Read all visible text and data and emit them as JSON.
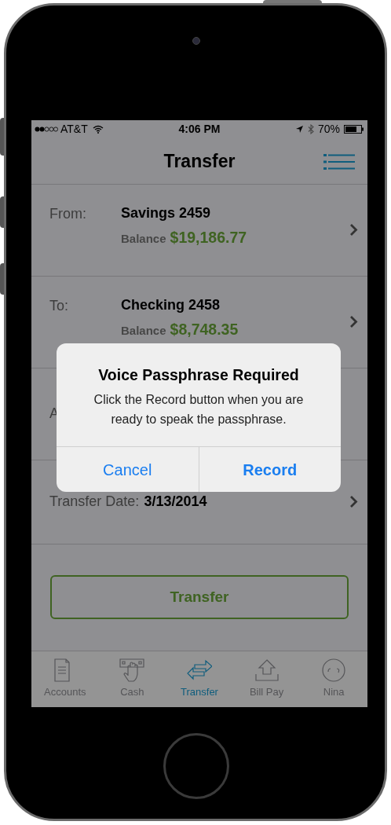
{
  "status_bar": {
    "carrier": "AT&T",
    "time": "4:06 PM",
    "battery": "70%"
  },
  "nav_bar": {
    "title": "Transfer"
  },
  "rows": [
    {
      "kind": "account",
      "label": "From:",
      "name": "Savings 2459",
      "balance_label": "Balance",
      "balance": "$19,186.77",
      "chevron": true
    },
    {
      "kind": "account",
      "label": "To:",
      "name": "Checking 2458",
      "balance_label": "Balance",
      "balance": "$8,748.35",
      "chevron": true
    },
    {
      "kind": "plain",
      "label": "A",
      "chevron": false
    },
    {
      "kind": "value",
      "label": "Transfer Date:",
      "value": "3/13/2014",
      "chevron": true
    }
  ],
  "transfer_button": "Transfer",
  "tab_bar": [
    {
      "label": "Accounts",
      "selected": false
    },
    {
      "label": "Cash",
      "selected": false
    },
    {
      "label": "Transfer",
      "selected": true
    },
    {
      "label": "Bill Pay",
      "selected": false
    },
    {
      "label": "Nina",
      "selected": false
    }
  ],
  "dialog": {
    "title": "Voice Passphrase Required",
    "message": "Click the Record button when you are ready to speak the passphrase.",
    "buttons": [
      {
        "label": "Cancel",
        "primary": false
      },
      {
        "label": "Record",
        "primary": true
      }
    ]
  }
}
